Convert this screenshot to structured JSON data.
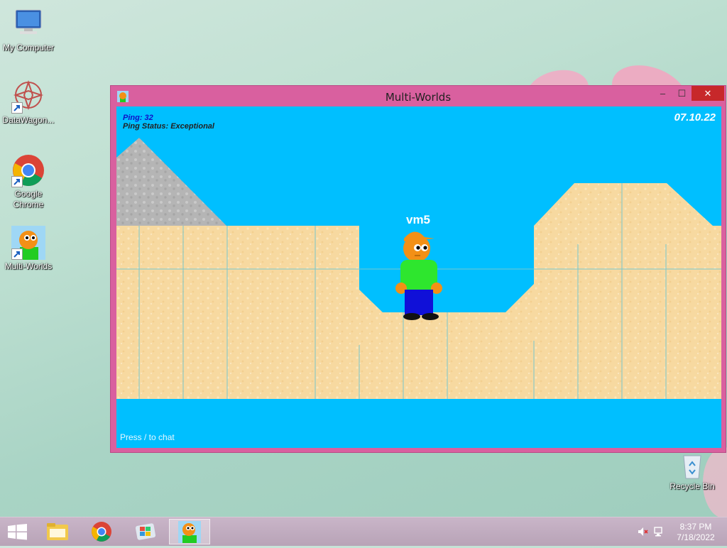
{
  "desktop": {
    "icons": [
      {
        "label": "My Computer"
      },
      {
        "label": "DataWagon..."
      },
      {
        "label": "Google Chrome"
      },
      {
        "label": "Multi-Worlds"
      },
      {
        "label": "Recycle Bin"
      }
    ]
  },
  "window": {
    "title": "Multi-Worlds",
    "controls": {
      "minimize": "–",
      "maximize": "☐",
      "close": "✕"
    }
  },
  "game": {
    "ping": "Ping: 32",
    "ping_status": "Ping Status: Exceptional",
    "date": "07.10.22",
    "player_name": "vm5",
    "chat_hint": "Press / to chat"
  },
  "taskbar": {
    "items": [
      "start-button",
      "file-explorer",
      "google-chrome",
      "windows-app",
      "multi-worlds"
    ],
    "active_item": "multi-worlds",
    "time": "8:37 PM",
    "date": "7/18/2022"
  },
  "colors": {
    "window_frame": "#d9609f",
    "sky": "#00bfff",
    "sand": "#f7d9a0",
    "close_button": "#c7282a"
  }
}
